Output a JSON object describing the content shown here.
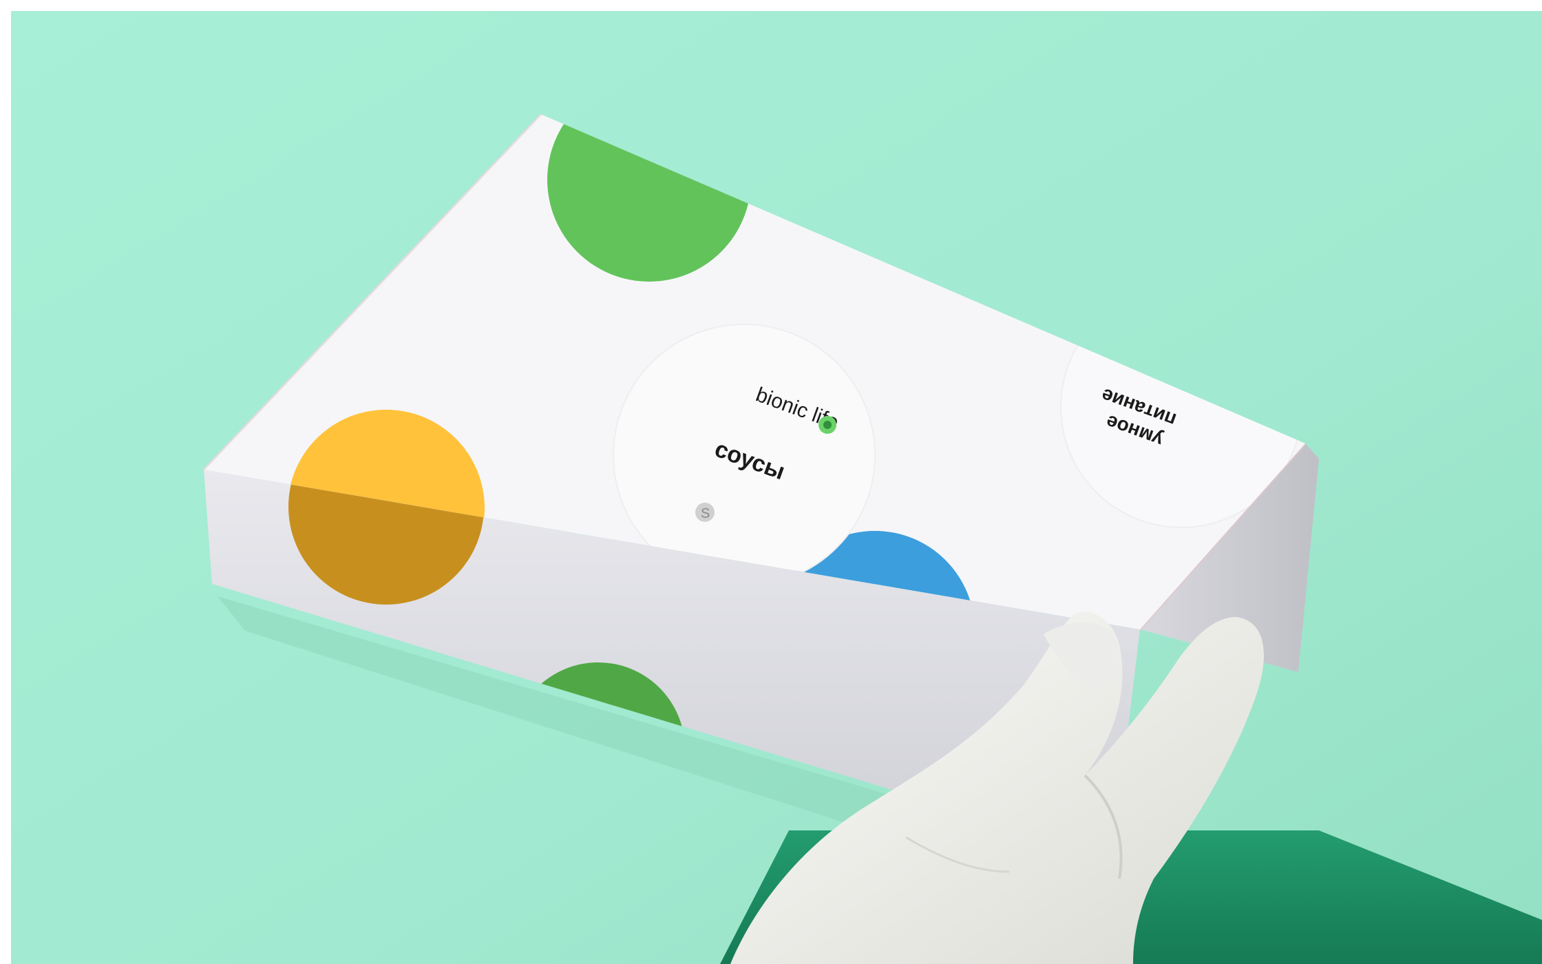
{
  "scene": {
    "description_alt": "",
    "colors": {
      "backdrop": "#a3ecd3",
      "backdrop_shadow": "#8fdcc0",
      "floor": "#1e8f66",
      "box_top": "#f5f5f8",
      "box_side": "#dedee4",
      "glove": "#f1f1ee",
      "dot_green": "#5fc15a",
      "dot_yellow": "#ffc23a",
      "dot_blue": "#3c9edd"
    }
  },
  "box": {
    "brand": "bionic life",
    "product_label": "соусы",
    "tagline_line1": "умное",
    "tagline_line2": "питание"
  }
}
